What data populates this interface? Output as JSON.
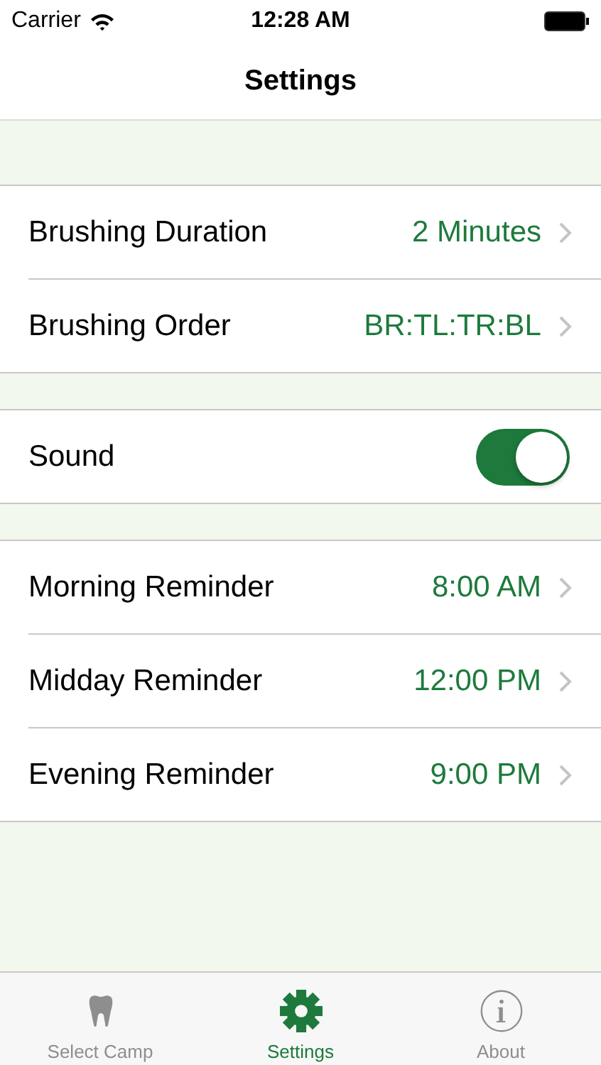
{
  "status_bar": {
    "carrier": "Carrier",
    "time": "12:28 AM"
  },
  "nav_bar": {
    "title": "Settings"
  },
  "groups": [
    {
      "rows": [
        {
          "kind": "value",
          "label": "Brushing Duration",
          "value": "2 Minutes"
        },
        {
          "kind": "value",
          "label": "Brushing Order",
          "value": "BR:TL:TR:BL"
        }
      ]
    },
    {
      "rows": [
        {
          "kind": "toggle",
          "label": "Sound",
          "on": true
        }
      ]
    },
    {
      "rows": [
        {
          "kind": "value",
          "label": "Morning Reminder",
          "value": "8:00 AM"
        },
        {
          "kind": "value",
          "label": "Midday Reminder",
          "value": "12:00 PM"
        },
        {
          "kind": "value",
          "label": "Evening Reminder",
          "value": "9:00 PM"
        }
      ]
    }
  ],
  "tab_bar": [
    {
      "kind": "tooth",
      "label": "Select Camp",
      "selected": false
    },
    {
      "kind": "gear",
      "label": "Settings",
      "selected": true
    },
    {
      "kind": "info",
      "label": "About",
      "selected": false
    }
  ]
}
